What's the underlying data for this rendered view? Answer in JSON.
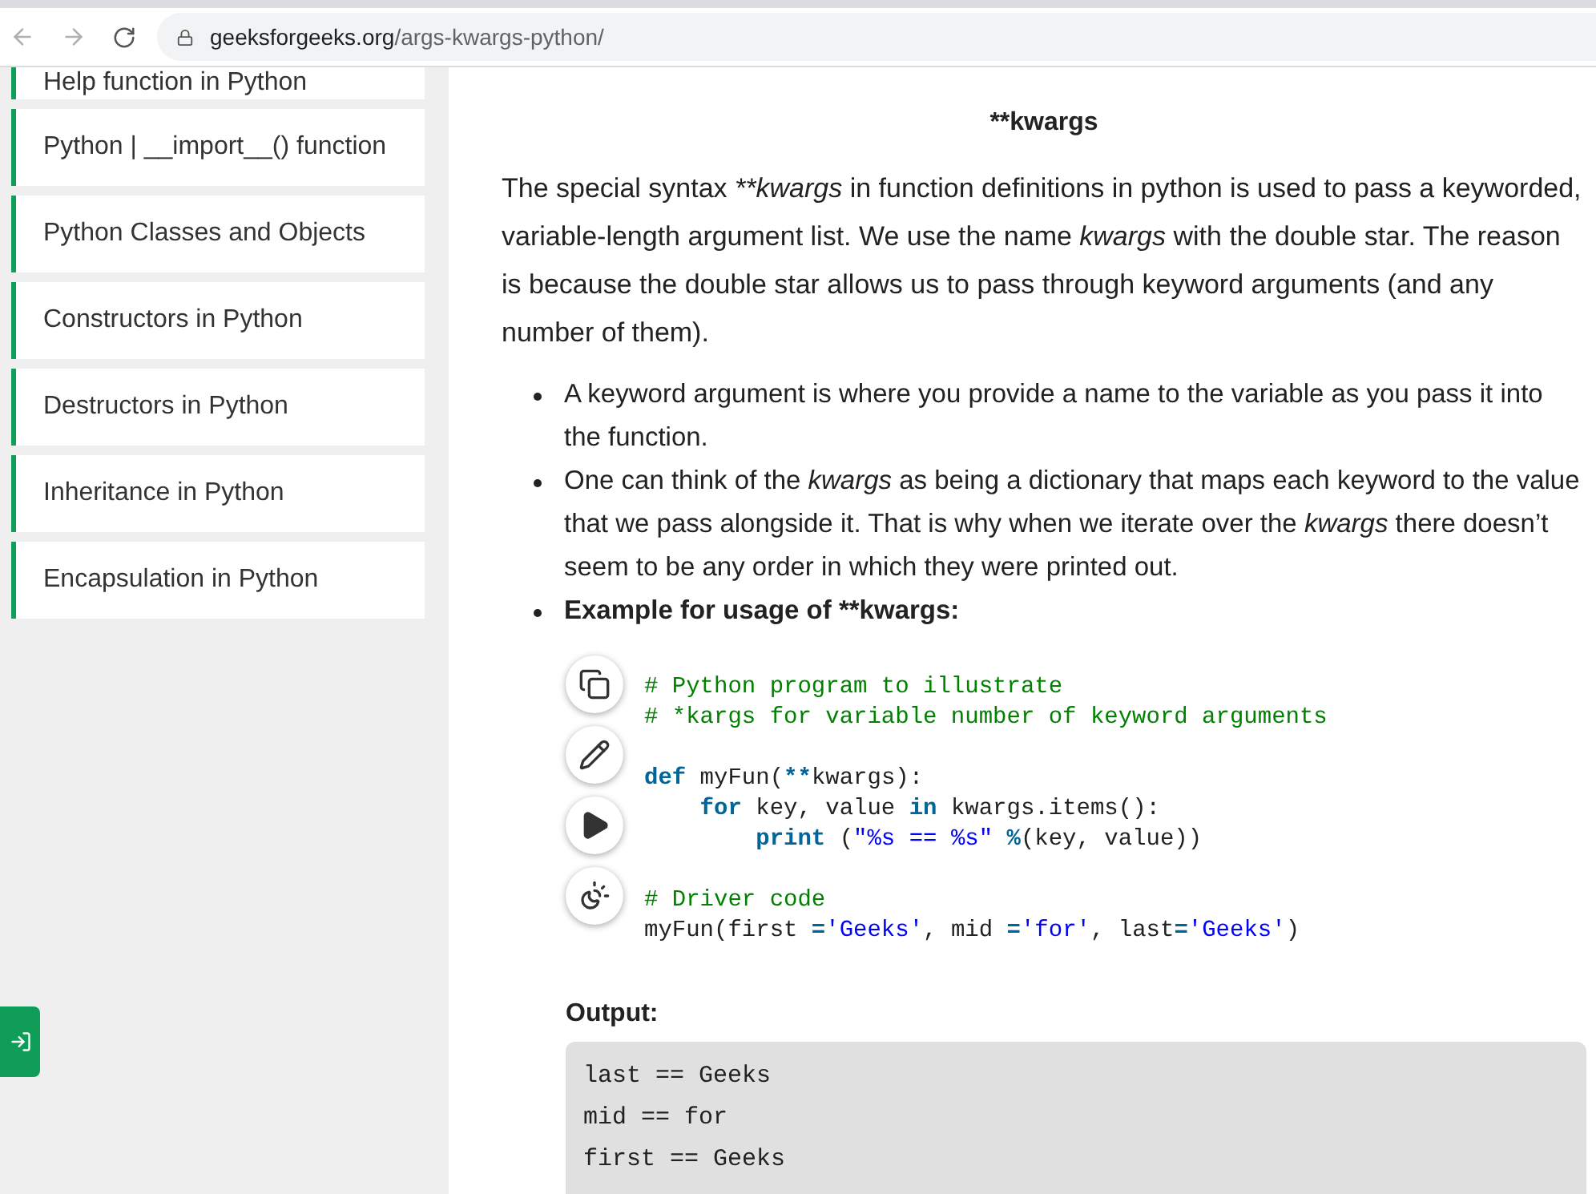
{
  "browser": {
    "url_host": "geeksforgeeks.org",
    "url_path": "/args-kwargs-python/"
  },
  "sidebar": {
    "items": [
      {
        "label": "Help function in Python"
      },
      {
        "label": "Python | __import__() function"
      },
      {
        "label": "Python Classes and Objects"
      },
      {
        "label": "Constructors in Python"
      },
      {
        "label": "Destructors in Python"
      },
      {
        "label": "Inheritance in Python"
      },
      {
        "label": "Encapsulation in Python"
      }
    ]
  },
  "article": {
    "heading": "**kwargs",
    "paragraph": [
      {
        "text": "The special syntax ",
        "kind": "plain"
      },
      {
        "text": "**kwargs",
        "kind": "emphasis"
      },
      {
        "text": " in function definitions in python is used to pass a keyworded, variable-length argument list. We use the name ",
        "kind": "plain"
      },
      {
        "text": "kwargs",
        "kind": "emphasis"
      },
      {
        "text": " with the double star. The reason is because the double star allows us to pass through keyword arguments (and any number of them).",
        "kind": "plain"
      }
    ],
    "bullets": [
      {
        "kind": "text",
        "segments": [
          {
            "text": "A keyword argument is where you provide a name to the variable as you pass it into the function.",
            "kind": "plain"
          }
        ]
      },
      {
        "kind": "text",
        "segments": [
          {
            "text": "One can think of the ",
            "kind": "plain"
          },
          {
            "text": "kwargs",
            "kind": "emphasis"
          },
          {
            "text": " as being a dictionary that maps each keyword to the value that we pass alongside it. That is why when we iterate over the ",
            "kind": "plain"
          },
          {
            "text": "kwargs",
            "kind": "emphasis"
          },
          {
            "text": " there doesn’t seem to be any order in which they were printed out.",
            "kind": "plain"
          }
        ]
      },
      {
        "kind": "strong",
        "segments": [
          {
            "text": "Example for usage of **kwargs:",
            "kind": "plain"
          }
        ]
      }
    ],
    "code_tools": [
      {
        "kind": "copy"
      },
      {
        "kind": "edit"
      },
      {
        "kind": "run"
      },
      {
        "kind": "theme"
      }
    ],
    "code_blocks": [
      [
        [
          {
            "kind": "comment",
            "text": "# Python program to illustrate"
          }
        ],
        [
          {
            "kind": "comment",
            "text": "# *kargs for variable number of keyword arguments"
          }
        ]
      ],
      [
        [
          {
            "kind": "keyword",
            "text": "def"
          },
          {
            "kind": "plain",
            "text": " myFun("
          },
          {
            "kind": "keyword",
            "text": "**"
          },
          {
            "kind": "plain",
            "text": "kwargs):"
          }
        ],
        [
          {
            "kind": "keyword",
            "text": "    for"
          },
          {
            "kind": "plain",
            "text": " key, value "
          },
          {
            "kind": "keyword",
            "text": "in"
          },
          {
            "kind": "plain",
            "text": " kwargs.items():"
          }
        ],
        [
          {
            "kind": "keyword",
            "text": "        print"
          },
          {
            "kind": "plain",
            "text": " ("
          },
          {
            "kind": "string",
            "text": "\"%s == %s\""
          },
          {
            "kind": "keyword",
            "text": " %"
          },
          {
            "kind": "plain",
            "text": "(key, value))"
          }
        ]
      ],
      [
        [
          {
            "kind": "comment",
            "text": "# Driver code"
          }
        ],
        [
          {
            "kind": "plain",
            "text": "myFun(first "
          },
          {
            "kind": "keyword",
            "text": "="
          },
          {
            "kind": "string",
            "text": "'Geeks'"
          },
          {
            "kind": "plain",
            "text": ", mid "
          },
          {
            "kind": "keyword",
            "text": "="
          },
          {
            "kind": "string",
            "text": "'for'"
          },
          {
            "kind": "plain",
            "text": ", last"
          },
          {
            "kind": "keyword",
            "text": "="
          },
          {
            "kind": "string",
            "text": "'Geeks'"
          },
          {
            "kind": "plain",
            "text": ")"
          }
        ]
      ]
    ],
    "output_label": "Output:",
    "output_lines": [
      "last == Geeks",
      "mid == for",
      "first == Geeks"
    ]
  }
}
